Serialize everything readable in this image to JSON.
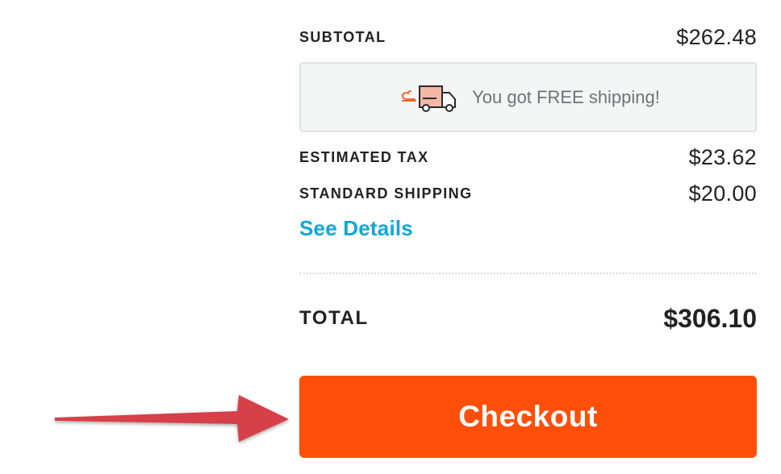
{
  "summary": {
    "subtotal_label": "SUBTOTAL",
    "subtotal_value": "$262.48",
    "shipping_banner": {
      "icon": "delivery-truck-icon",
      "message": "You got FREE shipping!"
    },
    "tax_label": "ESTIMATED TAX",
    "tax_value": "$23.62",
    "shipping_label": "STANDARD SHIPPING",
    "shipping_value": "$20.00",
    "details_link": "See Details",
    "total_label": "TOTAL",
    "total_value": "$306.10"
  },
  "checkout": {
    "label": "Checkout"
  },
  "annotation": {
    "icon": "red-arrow-pointer-icon"
  },
  "colors": {
    "checkout_button": "#ff4f0b",
    "link": "#12a6d6",
    "annotation_arrow": "#d6404a",
    "text": "#222222",
    "banner_background": "#f4f5f5",
    "truck_accent": "#f5b8a6"
  }
}
